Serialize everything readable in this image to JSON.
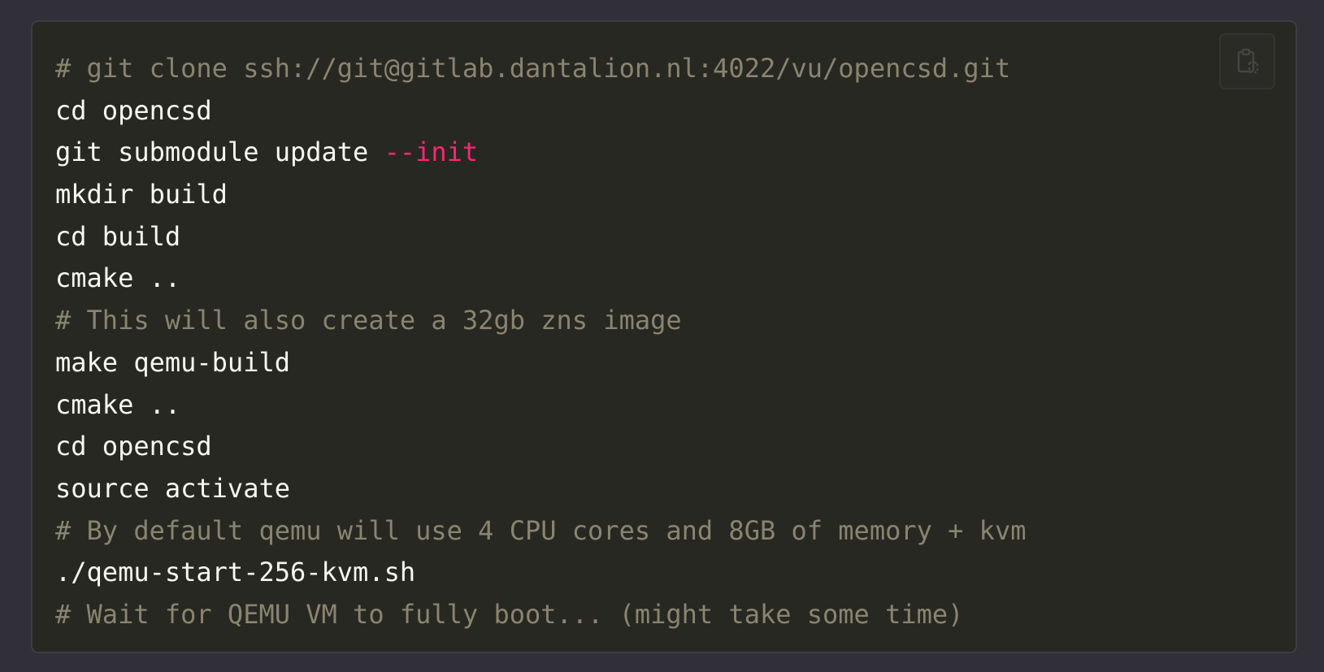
{
  "code": {
    "lines": [
      {
        "type": "comment",
        "text": "# git clone ssh://git@gitlab.dantalion.nl:4022/vu/opencsd.git"
      },
      {
        "type": "command",
        "text": "cd opencsd"
      },
      {
        "type": "command",
        "text": "git submodule update ",
        "flag": "--init"
      },
      {
        "type": "command",
        "text": "mkdir build"
      },
      {
        "type": "command",
        "text": "cd build"
      },
      {
        "type": "command",
        "text": "cmake .."
      },
      {
        "type": "comment",
        "text": "# This will also create a 32gb zns image"
      },
      {
        "type": "command",
        "text": "make qemu-build"
      },
      {
        "type": "command",
        "text": "cmake .."
      },
      {
        "type": "command",
        "text": "cd opencsd"
      },
      {
        "type": "command",
        "text": "source activate"
      },
      {
        "type": "comment",
        "text": "# By default qemu will use 4 CPU cores and 8GB of memory + kvm"
      },
      {
        "type": "command",
        "text": "./qemu-start-256-kvm.sh"
      },
      {
        "type": "comment",
        "text": "# Wait for QEMU VM to fully boot... (might take some time)"
      }
    ]
  },
  "copy_button": {
    "icon": "clipboard-copy-icon"
  },
  "colors": {
    "page_background": "#313039",
    "code_background": "#272822",
    "code_text": "#f8f8f2",
    "comment": "#8a8470",
    "flag": "#f92672"
  }
}
